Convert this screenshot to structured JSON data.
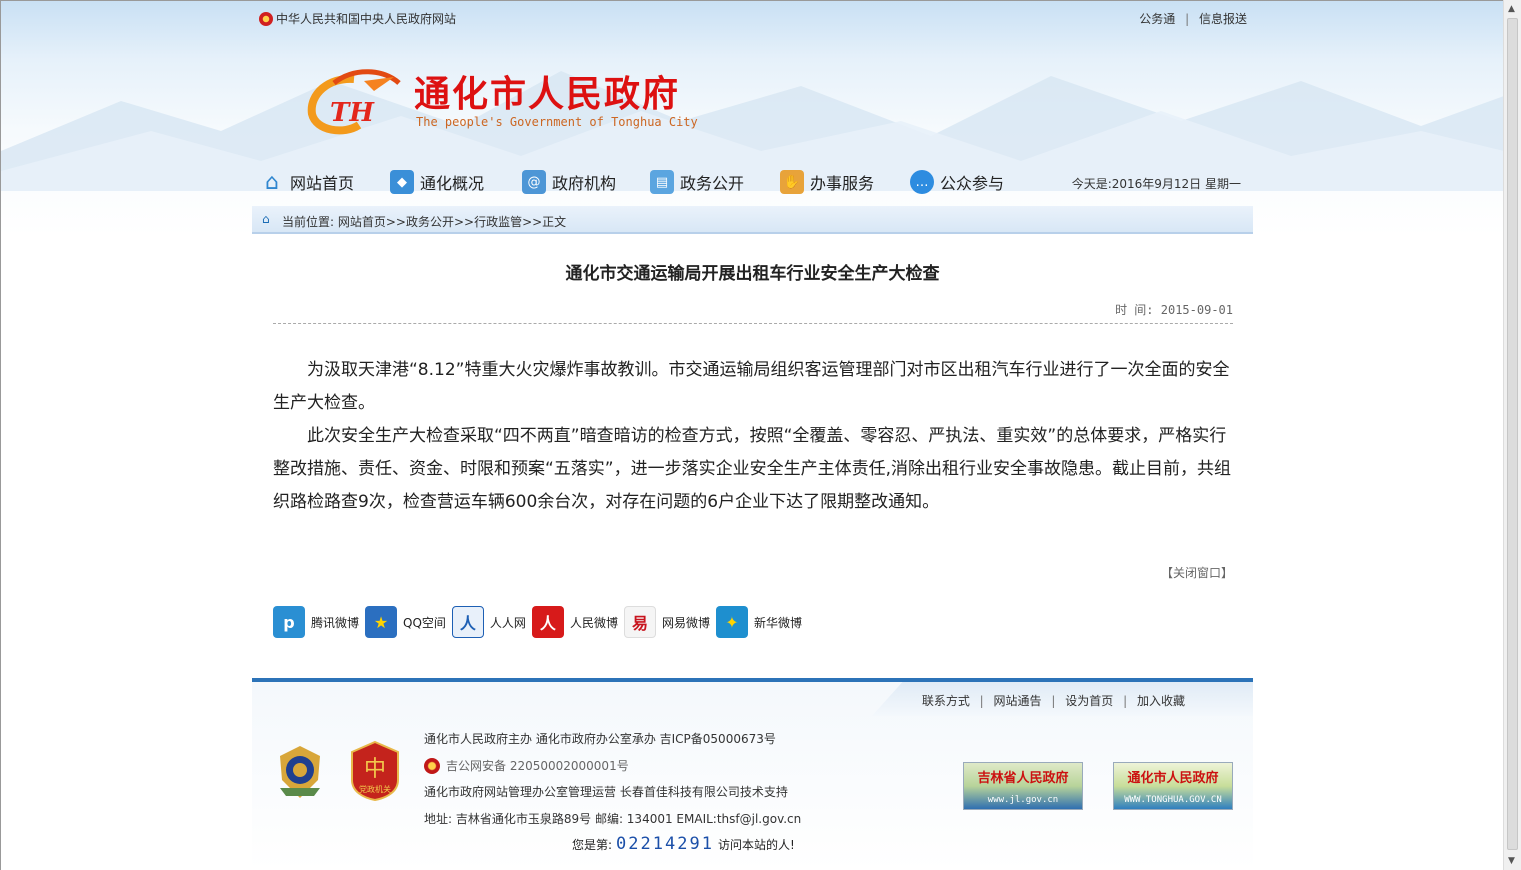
{
  "topbar": {
    "site_name": "中华人民共和国中央人民政府网站",
    "links": [
      "公务通",
      "信息报送"
    ]
  },
  "logo": {
    "title": "通化市人民政府",
    "subtitle": "The people's Government of Tonghua City",
    "mark_text": "TH"
  },
  "nav": {
    "items": [
      {
        "label": "网站首页",
        "icon": "home-icon"
      },
      {
        "label": "通化概况",
        "icon": "overview-icon"
      },
      {
        "label": "政府机构",
        "icon": "agency-icon"
      },
      {
        "label": "政务公开",
        "icon": "document-icon"
      },
      {
        "label": "办事服务",
        "icon": "service-icon"
      },
      {
        "label": "公众参与",
        "icon": "chat-icon"
      }
    ],
    "date_text": "今天是:2016年9月12日  星期一"
  },
  "breadcrumb": {
    "text": "当前位置:  网站首页>>政务公开>>行政监管>>正文"
  },
  "article": {
    "title": "通化市交通运输局开展出租车行业安全生产大检查",
    "meta": "时 间: 2015-09-01",
    "paragraphs": [
      "为汲取天津港“8.12”特重大火灾爆炸事故教训。市交通运输局组织客运管理部门对市区出租汽车行业进行了一次全面的安全生产大检查。",
      "此次安全生产大检查采取“四不两直”暗查暗访的检查方式，按照“全覆盖、零容忍、严执法、重实效”的总体要求，严格实行整改措施、责任、资金、时限和预案“五落实”，进一步落实企业安全生产主体责任,消除出租行业安全事故隐患。截止目前，共组织路检路查9次，检查营运车辆600余台次，对存在问题的6户企业下达了限期整改通知。"
    ],
    "close_label": "【关闭窗口】"
  },
  "share": {
    "items": [
      {
        "label": "腾讯微博",
        "icon": "tencent-weibo-icon",
        "color": "#2a8fd3"
      },
      {
        "label": "QQ空间",
        "icon": "qzone-icon",
        "color": "#2b6fc0"
      },
      {
        "label": "人人网",
        "icon": "renren-icon",
        "color": "#1d5fb4"
      },
      {
        "label": "人民微博",
        "icon": "people-weibo-icon",
        "color": "#d71a1a"
      },
      {
        "label": "网易微博",
        "icon": "netease-weibo-icon",
        "color": "#c8141e"
      },
      {
        "label": "新华微博",
        "icon": "xinhua-weibo-icon",
        "color": "#1e8fcf"
      }
    ]
  },
  "footer": {
    "links": [
      "联系方式",
      "网站通告",
      "设为首页",
      "加入收藏"
    ],
    "line1": "通化市人民政府主办 通化市政府办公室承办 吉ICP备05000673号",
    "police": "吉公网安备 22050002000001号",
    "line3": "通化市政府网站管理办公室管理运营 长春首佳科技有限公司技术支持",
    "line4": "地址: 吉林省通化市玉泉路89号 邮编: 134001 EMAIL:thsf@jl.gov.cn",
    "counter_prefix": "您是第:",
    "counter_number": "02214291",
    "counter_suffix": "访问本站的人!",
    "badge_text": "党政机关",
    "gov_links": [
      {
        "title": "吉林省人民政府",
        "url_text": "www.jl.gov.cn"
      },
      {
        "title": "通化市人民政府",
        "url_text": "WWW.TONGHUA.GOV.CN"
      }
    ]
  }
}
